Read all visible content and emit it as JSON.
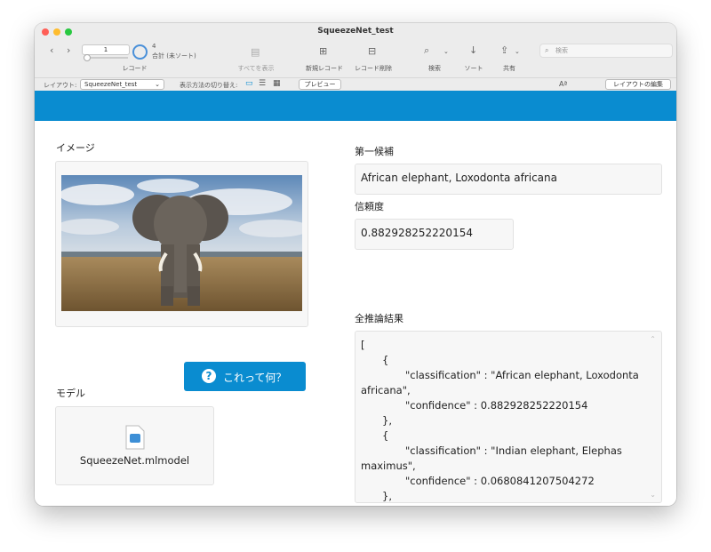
{
  "window": {
    "title": "SqueezeNet_test"
  },
  "toolbar": {
    "record_number": "1",
    "record_count": "4",
    "record_sort": "合計 (未ソート)",
    "record_label": "レコード",
    "show_all_label": "すべてを表示",
    "new_record_label": "新規レコード",
    "delete_record_label": "レコード削除",
    "find_label": "検索",
    "sort_label": "ソート",
    "share_label": "共有",
    "search_placeholder": "検索"
  },
  "layoutbar": {
    "layout_label": "レイアウト:",
    "layout_value": "SqueezeNet_test",
    "view_as_label": "表示方法の切り替え:",
    "preview_label": "プレビュー",
    "edit_layout_label": "レイアウトの編集"
  },
  "form": {
    "image_label": "イメージ",
    "model_label": "モデル",
    "model_filename": "SqueezeNet.mlmodel",
    "button_label": "これって何？",
    "first_candidate_label": "第一候補",
    "first_candidate_value": "African elephant, Loxodonta africana",
    "confidence_label": "信頼度",
    "confidence_value": "0.882928252220154",
    "all_results_label": "全推論結果",
    "all_results_lines": [
      "[",
      "{",
      "\"classification\" : \"African elephant, Loxodonta",
      "africana\",",
      "\"confidence\" : 0.882928252220154",
      "},",
      "{",
      "\"classification\" : \"Indian elephant, Elephas",
      "maximus\",",
      "\"confidence\" : 0.0680841207504272",
      "},"
    ]
  },
  "colors": {
    "accent": "#0a8cd0",
    "close": "#ff5f57",
    "minimize": "#febc2e",
    "zoom": "#28c840"
  }
}
